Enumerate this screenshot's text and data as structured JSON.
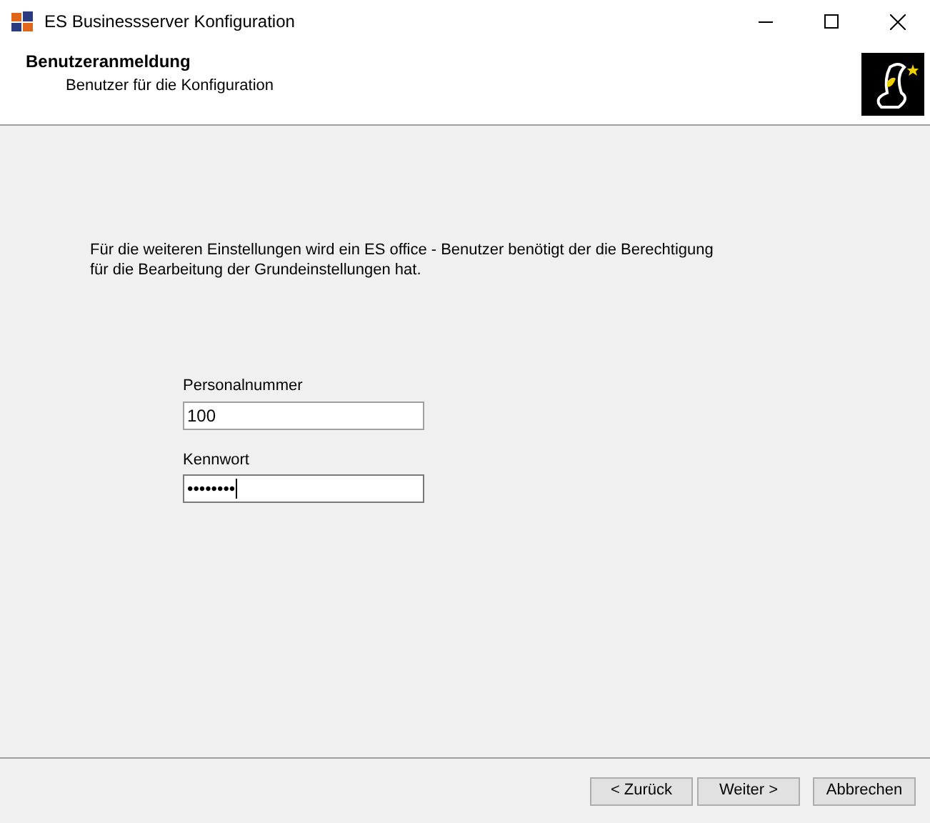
{
  "window": {
    "title": "ES Businessserver Konfiguration"
  },
  "header": {
    "title": "Benutzeranmeldung",
    "subtitle": "Benutzer für die Konfiguration"
  },
  "description": "Für die weiteren Einstellungen wird ein ES office - Benutzer benötigt der die Berechtigung für die Bearbeitung der Grundeinstellungen hat.",
  "fields": [
    {
      "label": "Personalnummer",
      "value": "100",
      "focused": false
    },
    {
      "label": "Kennwort",
      "value": "••••••••",
      "focused": true
    }
  ],
  "buttons": [
    "< Zurück",
    "Weiter >",
    "Abbrechen"
  ]
}
